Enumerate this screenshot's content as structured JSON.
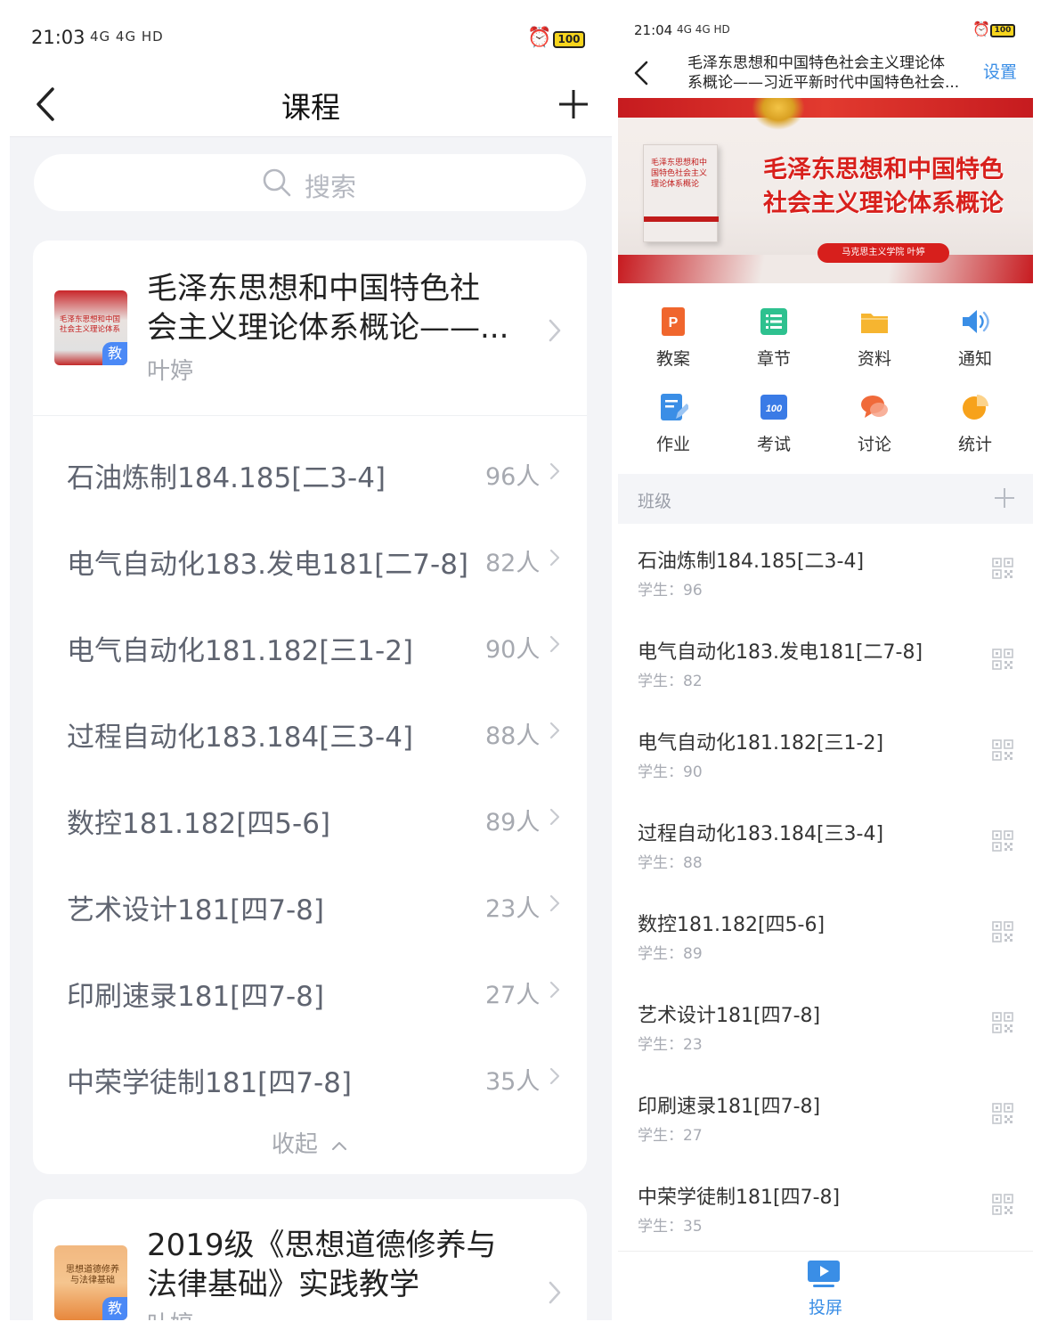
{
  "left": {
    "status": {
      "time": "21:03",
      "signal": "4G 4G HD",
      "battery": "100"
    },
    "nav": {
      "title": "课程"
    },
    "search": {
      "placeholder": "搜索"
    },
    "courses": [
      {
        "title_line1": "毛泽东思想和中国特色社",
        "title_line2": "会主义理论体系概论——...",
        "teacher": "叶婷",
        "cover_text": "毛泽东思想和中国社会主义理论体系",
        "badge": "教"
      },
      {
        "title_line1": "2019级《思想道德修养与",
        "title_line2": "法律基础》实践教学",
        "teacher": "叶婷",
        "cover_text": "思想道德修养与法律基础",
        "badge": "教"
      }
    ],
    "classes": [
      {
        "name": "石油炼制184.185[二3-4]",
        "count": "96人"
      },
      {
        "name": "电气自动化183.发电181[二7-8]",
        "count": "82人"
      },
      {
        "name": "电气自动化181.182[三1-2]",
        "count": "90人"
      },
      {
        "name": "过程自动化183.184[三3-4]",
        "count": "88人"
      },
      {
        "name": "数控181.182[四5-6]",
        "count": "89人"
      },
      {
        "name": "艺术设计181[四7-8]",
        "count": "23人"
      },
      {
        "name": "印刷速录181[四7-8]",
        "count": "27人"
      },
      {
        "name": "中荣学徒制181[四7-8]",
        "count": "35人"
      }
    ],
    "collapse_label": "收起"
  },
  "right": {
    "status": {
      "time": "21:04",
      "signal": "4G 4G HD",
      "battery": "100"
    },
    "nav": {
      "title_line1": "毛泽东思想和中国特色社会主义理论体",
      "title_line2": "系概论——习近平新时代中国特色社会...",
      "settings": "设置"
    },
    "banner": {
      "book_text": "毛泽东思想和中国特色社会主义理论体系概论",
      "headline_line1": "毛泽东思想和中国特色",
      "headline_line2": "社会主义理论体系概论",
      "pill": "马克思主义学院 叶婷"
    },
    "grid": [
      {
        "label": "教案",
        "icon": "ppt-icon",
        "color": "#f0662d"
      },
      {
        "label": "章节",
        "icon": "list-icon",
        "color": "#2ec18f"
      },
      {
        "label": "资料",
        "icon": "folder-icon",
        "color": "#f6b530"
      },
      {
        "label": "通知",
        "icon": "speaker-icon",
        "color": "#3a8ee6"
      },
      {
        "label": "作业",
        "icon": "edit-icon",
        "color": "#3a8ee6"
      },
      {
        "label": "考试",
        "icon": "exam-icon",
        "color": "#3a7be6"
      },
      {
        "label": "讨论",
        "icon": "chat-icon",
        "color": "#f06a3a"
      },
      {
        "label": "统计",
        "icon": "pie-icon",
        "color": "#f7a21b"
      }
    ],
    "exam_icon_text": "100",
    "section": {
      "label": "班级"
    },
    "classes": [
      {
        "name": "石油炼制184.185[二3-4]",
        "students": "学生：96"
      },
      {
        "name": "电气自动化183.发电181[二7-8]",
        "students": "学生：82"
      },
      {
        "name": "电气自动化181.182[三1-2]",
        "students": "学生：90"
      },
      {
        "name": "过程自动化183.184[三3-4]",
        "students": "学生：88"
      },
      {
        "name": "数控181.182[四5-6]",
        "students": "学生：89"
      },
      {
        "name": "艺术设计181[四7-8]",
        "students": "学生：23"
      },
      {
        "name": "印刷速录181[四7-8]",
        "students": "学生：27"
      },
      {
        "name": "中荣学徒制181[四7-8]",
        "students": "学生：35"
      }
    ],
    "bottom": {
      "label": "投屏",
      "icon": "screen-cast-icon"
    }
  },
  "colors": {
    "accent_blue": "#3a8ee6",
    "badge_blue": "#4b89f6",
    "banner_red": "#d8201c"
  }
}
